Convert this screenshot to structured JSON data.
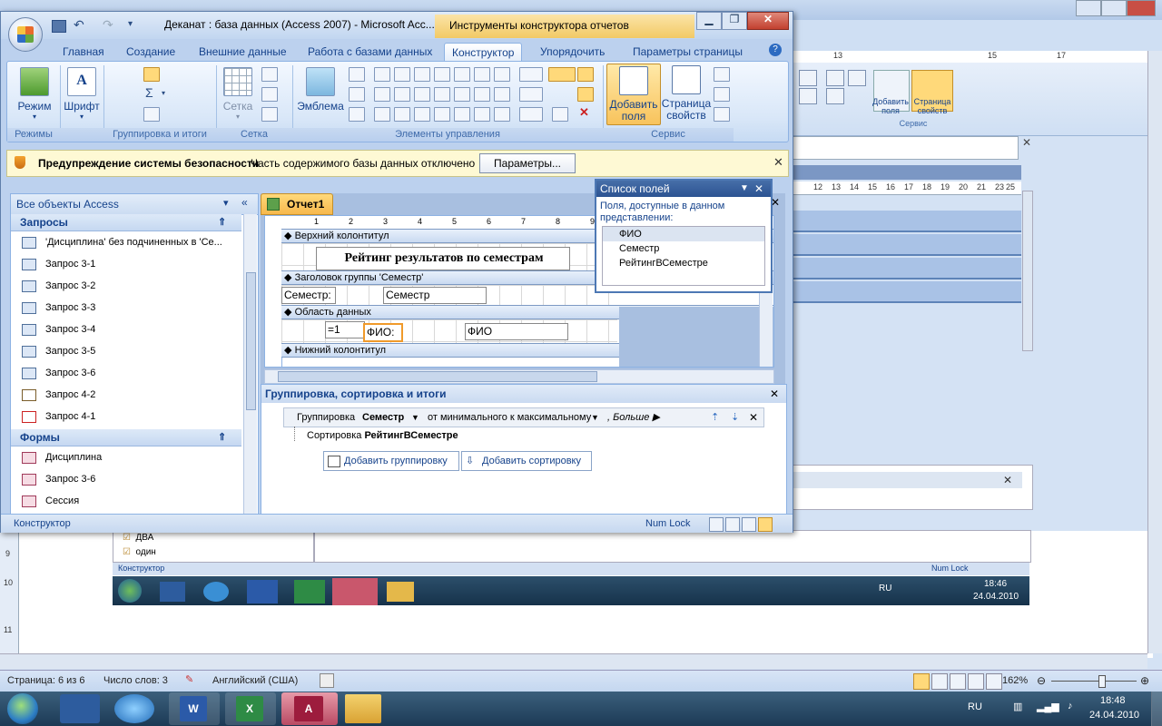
{
  "background_word": {
    "ribbon_labels": {
      "add_fields": "Добавить поля",
      "property_sheet": "Страница свойств",
      "service": "Сервис"
    },
    "ruler_numbers": [
      "13",
      "15",
      "17"
    ],
    "ruler2_numbers": [
      "12",
      "13",
      "14",
      "15",
      "16",
      "17",
      "18",
      "19",
      "20",
      "21",
      "22",
      "23",
      "24",
      "25"
    ],
    "embedded_list": [
      "ДВА",
      "один"
    ],
    "embedded_status_left": "Конструктор",
    "embedded_status_right": "Num Lock",
    "embedded_tray_lang": "RU",
    "embedded_time": "18:46",
    "embedded_date": "24.04.2010",
    "status": {
      "page": "Страница: 6 из 6",
      "words": "Число слов: 3",
      "language": "Английский (США)",
      "zoom": "162%"
    },
    "left_ruler": [
      "9",
      "10",
      "11"
    ]
  },
  "access": {
    "title": "Деканат : база данных (Access 2007) - Microsoft Acc...",
    "context_title": "Инструменты конструктора отчетов",
    "tabs": [
      "Главная",
      "Создание",
      "Внешние данные",
      "Работа с базами данных",
      "Конструктор",
      "Упорядочить",
      "Параметры страницы"
    ],
    "active_tab": "Конструктор",
    "ribbon": {
      "modes_btn": "Режим",
      "modes_group": "Режимы",
      "font_btn": "Шрифт",
      "grouping_group": "Группировка и итоги",
      "grid_btn": "Сетка",
      "grid_group": "Сетка",
      "emblem_btn": "Эмблема",
      "controls_group": "Элементы управления",
      "add_fields_btn": "Добавить поля",
      "property_sheet_btn": "Страница свойств",
      "service_group": "Сервис"
    },
    "security": {
      "title": "Предупреждение системы безопасности",
      "message": "Часть содержимого базы данных отключено",
      "button": "Параметры..."
    },
    "nav": {
      "header": "Все объекты Access",
      "queries_header": "Запросы",
      "queries": [
        "'Дисциплина' без подчиненных в 'Се...",
        "Запрос 3-1",
        "Запрос 3-2",
        "Запрос 3-3",
        "Запрос 3-4",
        "Запрос 3-5",
        "Запрос 3-6",
        "Запрос 4-2",
        "Запрос 4-1"
      ],
      "forms_header": "Формы",
      "forms": [
        "Дисциплина",
        "Запрос 3-6",
        "Сессия"
      ]
    },
    "document": {
      "tab": "Отчет1",
      "bands": {
        "page_header": "Верхний колонтитул",
        "group_header": "Заголовок группы 'Семестр'",
        "detail": "Область данных",
        "page_footer": "Нижний колонтитул"
      },
      "title_label": "Рейтинг результатов по семестрам",
      "semester_label": "Семестр:",
      "semester_field": "Семестр",
      "counter": "=1",
      "fio_label": "ФИО:",
      "fio_field": "ФИО",
      "ruler": [
        "1",
        "2",
        "3",
        "4",
        "5",
        "6",
        "7",
        "8",
        "9"
      ]
    },
    "field_list": {
      "title": "Список полей",
      "caption": "Поля, доступные в данном представлении:",
      "fields": [
        "ФИО",
        "Семестр",
        "РейтингВСеместре"
      ]
    },
    "group_sort": {
      "title": "Группировка, сортировка и итоги",
      "group_prefix": "Группировка",
      "group_field": "Семестр",
      "group_order": "от минимального к максимальному",
      "more": "Больше",
      "sort_prefix": "Сортировка",
      "sort_field": "РейтингВСеместре",
      "add_group_btn": "Добавить группировку",
      "add_sort_btn": "Добавить сортировку"
    },
    "status_left": "Конструктор",
    "status_right": "Num Lock"
  },
  "taskbar": {
    "lang": "RU",
    "time": "18:48",
    "date": "24.04.2010"
  },
  "colors": {
    "accent": "#15428b",
    "active_tab": "#f7b84c",
    "title_bar": "#c2d6f0"
  }
}
